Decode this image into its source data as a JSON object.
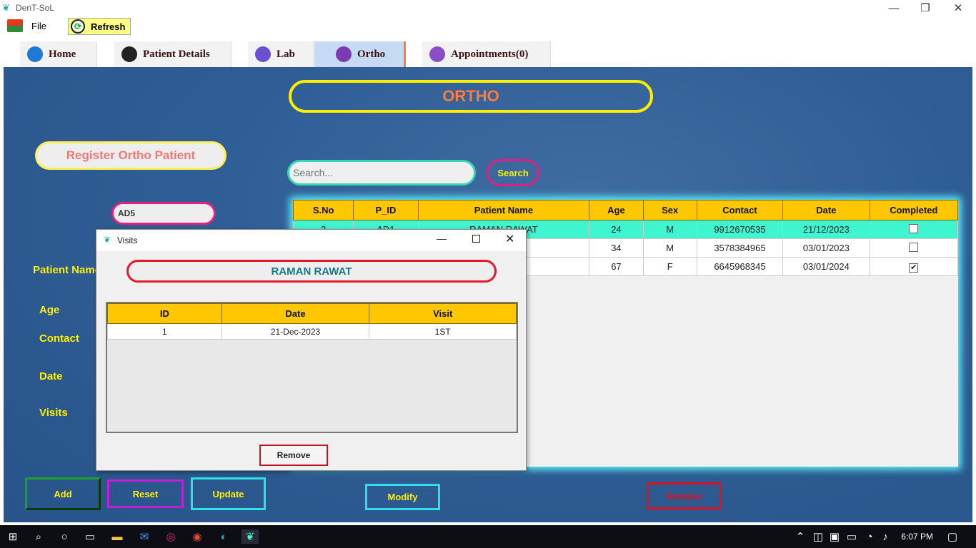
{
  "window": {
    "title": "DenT-SoL",
    "minimize": "—",
    "restore": "❐",
    "close": "✕"
  },
  "menu": {
    "file": "File",
    "refresh": "Refresh"
  },
  "tabs": [
    {
      "label": "Home",
      "icon": "home-icon",
      "color": "#1e7ad6"
    },
    {
      "label": "Patient Details",
      "icon": "user-icon",
      "color": "#222"
    },
    {
      "label": "Lab",
      "icon": "flask-icon",
      "color": "#6a4fd0"
    },
    {
      "label": "Ortho",
      "icon": "ortho-icon",
      "color": "#7a3bb0"
    },
    {
      "label": "Appointments(0)",
      "icon": "calendar-icon",
      "color": "#8a4fc8"
    }
  ],
  "main": {
    "title": "ORTHO",
    "register": "Register Ortho Patient",
    "search_placeholder": "Search...",
    "search_button": "Search",
    "patient_id": "AD5",
    "labels": {
      "name": "Patient Name",
      "age": "Age",
      "contact": "Contact",
      "date": "Date",
      "visits": "Visits"
    }
  },
  "table": {
    "headers": [
      "S.No",
      "P_ID",
      "Patient Name",
      "Age",
      "Sex",
      "Contact",
      "Date",
      "Completed"
    ],
    "rows": [
      {
        "sno": "2",
        "pid": "AD1",
        "name": "RAMAN RAWAT",
        "age": "24",
        "sex": "M",
        "contact": "9912670535",
        "date": "21/12/2023",
        "completed": false
      },
      {
        "sno": "",
        "pid": "",
        "name": "",
        "age": "34",
        "sex": "M",
        "contact": "3578384965",
        "date": "03/01/2023",
        "completed": false
      },
      {
        "sno": "",
        "pid": "",
        "name": "",
        "age": "67",
        "sex": "F",
        "contact": "6645968345",
        "date": "03/01/2024",
        "completed": true
      }
    ]
  },
  "buttons": {
    "add": "Add",
    "reset": "Reset",
    "update": "Update",
    "modify": "Modify",
    "remove": "Remove"
  },
  "dialog": {
    "title": "Visits",
    "patient": "RAMAN RAWAT",
    "headers": [
      "ID",
      "Date",
      "Visit"
    ],
    "rows": [
      {
        "id": "1",
        "date": "21-Dec-2023",
        "visit": "1ST"
      }
    ],
    "remove": "Remove"
  },
  "taskbar": {
    "time": "6:07 PM"
  },
  "colors": {
    "accent_yellow": "#ffee00",
    "header_gold": "#ffc700",
    "selected_row": "#3ff5d0",
    "panel_blue": "#2f5d95"
  }
}
